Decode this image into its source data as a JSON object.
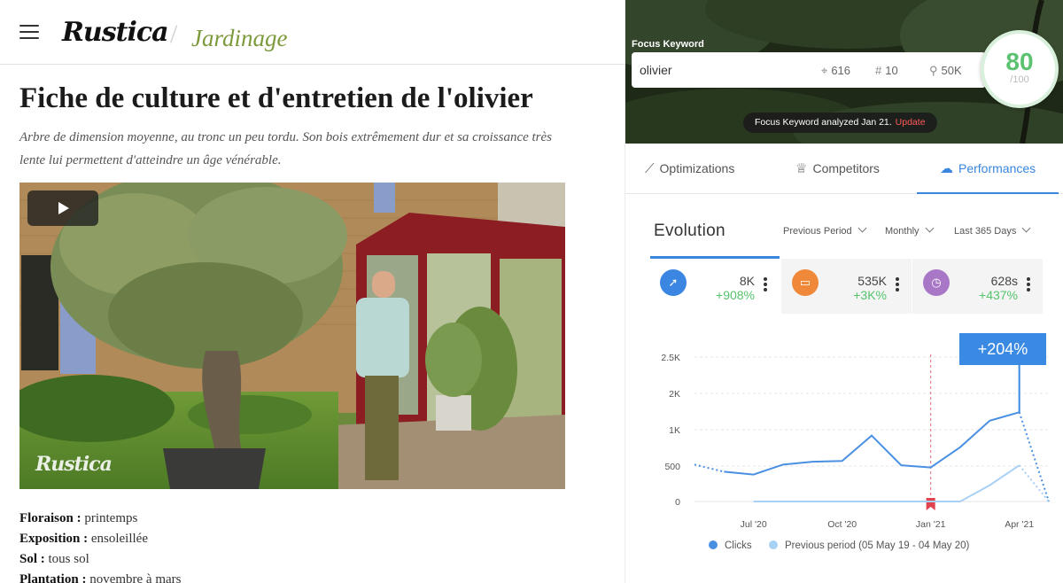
{
  "site": {
    "logo": "Rustica",
    "section": "Jardinage",
    "article_title": "Fiche de culture et d'entretien de l'olivier",
    "intro": "Arbre de dimension moyenne, au tronc un peu tordu. Son bois extrêmement dur et sa croissance très lente lui permettent d'atteindre un âge vénérable.",
    "video_watermark": "Rustica",
    "facts": [
      {
        "label": "Floraison",
        "value": "printemps"
      },
      {
        "label": "Exposition",
        "value": "ensoleillée"
      },
      {
        "label": "Sol",
        "value": "tous sol"
      },
      {
        "label": "Plantation",
        "value": "novembre à mars"
      }
    ]
  },
  "seo": {
    "focus_label": "Focus Keyword",
    "keyword": "olivier",
    "stats": {
      "clicks": "616",
      "rank": "10",
      "volume": "50K"
    },
    "score": {
      "value": "80",
      "max": "/100"
    },
    "analyzed_text": "Focus Keyword analyzed Jan 21.",
    "update_label": "Update",
    "tabs": [
      {
        "label": "Optimizations",
        "icon": "trend-icon"
      },
      {
        "label": "Competitors",
        "icon": "trophy-icon"
      },
      {
        "label": "Performances",
        "icon": "cloud-icon",
        "active": true
      }
    ],
    "evolution_title": "Evolution",
    "filters": {
      "comparison": "Previous Period",
      "granularity": "Monthly",
      "range": "Last 365 Days"
    },
    "metrics": [
      {
        "value": "8K",
        "delta": "+908%",
        "icon": "cursor-icon",
        "color": "#3a86e0"
      },
      {
        "value": "535K",
        "delta": "+3K%",
        "icon": "eye-icon",
        "color": "#f0883a"
      },
      {
        "value": "628s",
        "delta": "+437%",
        "icon": "clock-icon",
        "color": "#a878c7"
      }
    ],
    "badge": "+204%",
    "legend": {
      "current": "Clicks",
      "previous": "Previous period (05 May 19 - 04 May 20)"
    },
    "colors": {
      "accent": "#3a86e0",
      "positive": "#55c46d",
      "score": "#5dc172",
      "update": "#ff5a5a"
    }
  },
  "chart_data": {
    "type": "line",
    "y_ticks": [
      "0",
      "500",
      "1K",
      "2K",
      "2.5K"
    ],
    "x_ticks": [
      "Jul '20",
      "Oct '20",
      "Jan '21",
      "Apr '21"
    ],
    "series": [
      {
        "name": "Clicks",
        "color": "#4a90e2",
        "values": [
          520,
          420,
          380,
          520,
          560,
          570,
          920,
          510,
          480,
          760,
          1250,
          1480,
          0
        ]
      },
      {
        "name": "Previous period (05 May 19 - 04 May 20)",
        "color": "#a9d1f5",
        "values": [
          null,
          null,
          0,
          0,
          0,
          0,
          0,
          0,
          0,
          0,
          230,
          510,
          0
        ]
      }
    ],
    "marker": "Jan '21",
    "annotation": "+204%"
  }
}
